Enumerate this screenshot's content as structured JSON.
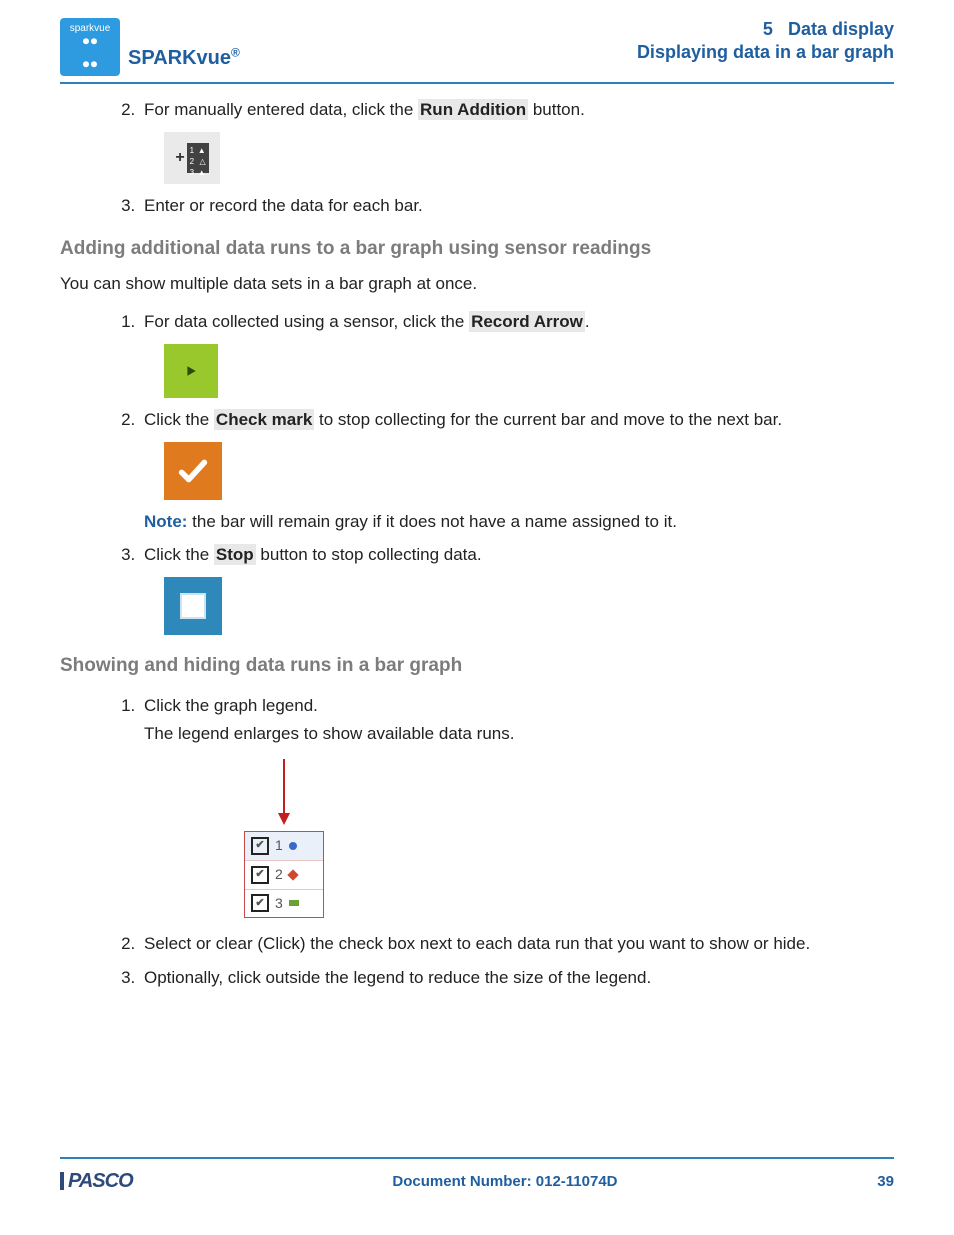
{
  "header": {
    "logo_brand": "sparkvue",
    "app_name": "SPARKvue",
    "app_reg": "®",
    "chapter_num": "5",
    "chapter_title": "Data display",
    "section_title": "Displaying data in a bar graph"
  },
  "block1": {
    "item2_pre": "For manually entered data, click the ",
    "item2_hl": "Run Addition",
    "item2_post": " button.",
    "item3": "Enter or record the data for each bar."
  },
  "section_sensor": {
    "heading": "Adding additional data runs to a bar graph using sensor readings",
    "intro": "You can show multiple data sets in a bar graph at once.",
    "item1_pre": "For data collected using a sensor, click the ",
    "item1_hl": "Record Arrow",
    "item1_post": ".",
    "item2_pre": "Click the ",
    "item2_hl": "Check mark",
    "item2_post": " to stop collecting for the current bar and move to the next bar.",
    "note_label": "Note:",
    "note_text": " the bar will remain gray if it does not have a name assigned to it.",
    "item3_pre": "Click the ",
    "item3_hl": "Stop",
    "item3_post": " button to stop collecting data."
  },
  "section_showhide": {
    "heading": "Showing and hiding data runs in a bar graph",
    "item1": "Click the graph legend.",
    "item1_sub": "The legend enlarges to show available data runs.",
    "legend_rows": [
      "1",
      "2",
      "3"
    ],
    "item2": "Select or clear (Click) the check box next to each data run that you want to show or hide.",
    "item3": "Optionally, click outside the legend to reduce the size of the legend."
  },
  "footer": {
    "brand": "PASCO",
    "doc_label": "Document Number: 012-11074D",
    "page": "39"
  }
}
